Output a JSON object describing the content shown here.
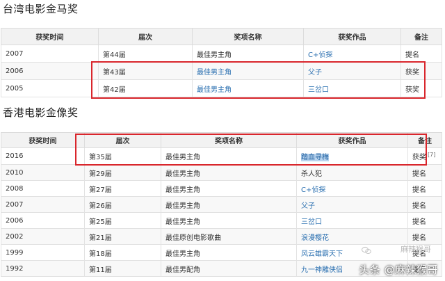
{
  "taiwan": {
    "title": "台湾电影金马奖",
    "headers": [
      "获奖时间",
      "届次",
      "奖项名称",
      "获奖作品",
      "备注"
    ],
    "rows": [
      {
        "year": "2007",
        "session": "第44届",
        "award": "最佳男主角",
        "work": "C+侦探",
        "note": "提名"
      },
      {
        "year": "2006",
        "session": "第43届",
        "award": "最佳男主角",
        "work": "父子",
        "note": "获奖"
      },
      {
        "year": "2005",
        "session": "第42届",
        "award": "最佳男主角",
        "work": "三岔口",
        "note": "获奖"
      }
    ]
  },
  "hongkong": {
    "title": "香港电影金像奖",
    "headers": [
      "获奖时间",
      "届次",
      "奖项名称",
      "获奖作品",
      "备注"
    ],
    "rows": [
      {
        "year": "2016",
        "session": "第35届",
        "award": "最佳男主角",
        "work": "踏血寻梅",
        "note": "获奖",
        "ref": "[7]"
      },
      {
        "year": "2010",
        "session": "第29届",
        "award": "最佳男主角",
        "work": "杀人犯",
        "note": "提名"
      },
      {
        "year": "2008",
        "session": "第27届",
        "award": "最佳男主角",
        "work": "C+侦探",
        "note": "提名"
      },
      {
        "year": "2007",
        "session": "第26届",
        "award": "最佳男主角",
        "work": "父子",
        "note": "提名"
      },
      {
        "year": "2006",
        "session": "第25届",
        "award": "最佳男主角",
        "work": "三岔口",
        "note": "提名"
      },
      {
        "year": "2002",
        "session": "第21届",
        "award": "最佳原创电影歌曲",
        "work": "浪漫樱花",
        "note": "提名"
      },
      {
        "year": "1999",
        "session": "第18届",
        "award": "最佳男主角",
        "work": "风云雄霸天下",
        "note": "提名"
      },
      {
        "year": "1992",
        "session": "第11届",
        "award": "最佳男配角",
        "work": "九一神雕侠侣",
        "note": "提名"
      }
    ]
  },
  "watermark": {
    "text": "头条 @麻辣猴哥",
    "faint_text": "麻辣猴哥"
  },
  "colors": {
    "highlight_box": "#d9262c",
    "link": "#2a6fb0",
    "selection": "#b9d4ef"
  }
}
